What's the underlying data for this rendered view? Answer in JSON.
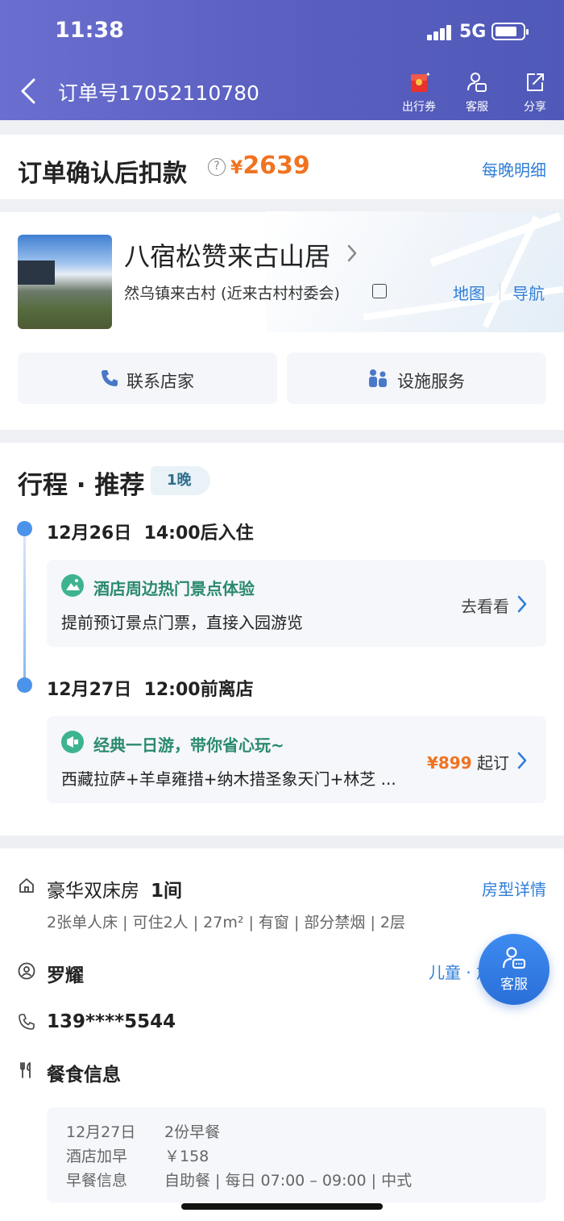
{
  "status_bar": {
    "time": "11:38",
    "network": "5G"
  },
  "header": {
    "order_title": "订单号17052110780",
    "buttons": [
      {
        "label": "出行券",
        "icon": "coupon-icon"
      },
      {
        "label": "客服",
        "icon": "customer-service-icon"
      },
      {
        "label": "分享",
        "icon": "share-icon"
      }
    ]
  },
  "payment": {
    "title": "订单确认后扣款",
    "help_icon": "?",
    "currency": "¥",
    "amount": "2639",
    "nightly_link": "每晚明细"
  },
  "hotel": {
    "name": "八宿松赞来古山居",
    "address": "然乌镇来古村 (近来古村村委会)",
    "map_link": "地图",
    "nav_link": "导航",
    "contact_button": "联系店家",
    "facilities_button": "设施服务"
  },
  "itinerary": {
    "title": "行程 · 推荐",
    "nights": "1晚",
    "checkin": {
      "date": "12月26日",
      "time": "14:00后入住"
    },
    "checkout": {
      "date": "12月27日",
      "time": "12:00前离店"
    },
    "recommend1": {
      "title": "酒店周边热门景点体验",
      "desc": "提前预订景点门票，直接入园游览",
      "action": "去看看"
    },
    "recommend2": {
      "title": "经典一日游，带你省心玩~",
      "desc": "西藏拉萨+羊卓雍措+纳木措圣象天门+林芝 ...",
      "price": "¥899",
      "price_suffix": "起订"
    }
  },
  "room": {
    "name": "豪华双床房",
    "count": "1间",
    "detail_link": "房型详情",
    "spec": "2张单人床 | 可住2人 | 27m² | 有窗 | 部分禁烟 | 2层"
  },
  "guest": {
    "name": "罗耀",
    "child_link": "儿童 · 加"
  },
  "contact": {
    "phone": "139****5544"
  },
  "meal": {
    "title": "餐食信息",
    "rows": [
      {
        "label": "12月27日",
        "value": "2份早餐"
      },
      {
        "label": "酒店加早",
        "value": "￥158"
      },
      {
        "label": "早餐信息",
        "value": "自助餐 | 每日 07:00 – 09:00 | 中式"
      }
    ]
  },
  "floating_service": {
    "label": "客服"
  },
  "colors": {
    "accent_blue": "#2f7ed8",
    "price_orange": "#f07321",
    "header_purple": "#5a5fc0",
    "green": "#3eb38f"
  }
}
